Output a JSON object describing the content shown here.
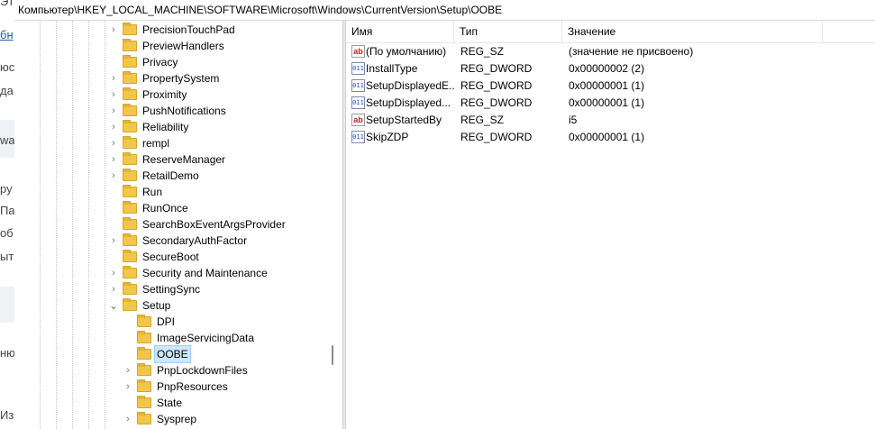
{
  "address_bar": {
    "path": "Компьютер\\HKEY_LOCAL_MACHINE\\SOFTWARE\\Microsoft\\Windows\\CurrentVersion\\Setup\\OOBE"
  },
  "background_page": {
    "fragments": [
      "Эт",
      "бн",
      "юс",
      "да",
      "wa",
      "ру",
      "Па",
      "об",
      "ыт",
      "ню",
      "Из"
    ]
  },
  "tree": {
    "nodes": [
      {
        "label": "PrecisionTouchPad",
        "expander": "collapsed",
        "level": 0
      },
      {
        "label": "PreviewHandlers",
        "expander": "none",
        "level": 0
      },
      {
        "label": "Privacy",
        "expander": "none",
        "level": 0
      },
      {
        "label": "PropertySystem",
        "expander": "collapsed",
        "level": 0
      },
      {
        "label": "Proximity",
        "expander": "collapsed",
        "level": 0
      },
      {
        "label": "PushNotifications",
        "expander": "collapsed",
        "level": 0
      },
      {
        "label": "Reliability",
        "expander": "collapsed",
        "level": 0
      },
      {
        "label": "rempl",
        "expander": "collapsed",
        "level": 0
      },
      {
        "label": "ReserveManager",
        "expander": "collapsed",
        "level": 0
      },
      {
        "label": "RetailDemo",
        "expander": "collapsed",
        "level": 0
      },
      {
        "label": "Run",
        "expander": "none",
        "level": 0
      },
      {
        "label": "RunOnce",
        "expander": "none",
        "level": 0
      },
      {
        "label": "SearchBoxEventArgsProvider",
        "expander": "none",
        "level": 0
      },
      {
        "label": "SecondaryAuthFactor",
        "expander": "collapsed",
        "level": 0
      },
      {
        "label": "SecureBoot",
        "expander": "none",
        "level": 0
      },
      {
        "label": "Security and Maintenance",
        "expander": "collapsed",
        "level": 0
      },
      {
        "label": "SettingSync",
        "expander": "collapsed",
        "level": 0
      },
      {
        "label": "Setup",
        "expander": "expanded",
        "level": 0
      },
      {
        "label": "DPI",
        "expander": "none",
        "level": 1
      },
      {
        "label": "ImageServicingData",
        "expander": "none",
        "level": 1
      },
      {
        "label": "OOBE",
        "expander": "none",
        "level": 1,
        "selected": true
      },
      {
        "label": "PnpLockdownFiles",
        "expander": "collapsed",
        "level": 1
      },
      {
        "label": "PnpResources",
        "expander": "collapsed",
        "level": 1
      },
      {
        "label": "State",
        "expander": "none",
        "level": 1
      },
      {
        "label": "Sysprep",
        "expander": "collapsed",
        "level": 1
      }
    ]
  },
  "values": {
    "columns": [
      "Имя",
      "Тип",
      "Значение"
    ],
    "rows": [
      {
        "icon": "reg-sz-icon",
        "name": "(По умолчанию)",
        "type": "REG_SZ",
        "data": "(значение не присвоено)"
      },
      {
        "icon": "reg-dword-icon",
        "name": "InstallType",
        "type": "REG_DWORD",
        "data": "0x00000002 (2)"
      },
      {
        "icon": "reg-dword-icon",
        "name": "SetupDisplayedE...",
        "type": "REG_DWORD",
        "data": "0x00000001 (1)"
      },
      {
        "icon": "reg-dword-icon",
        "name": "SetupDisplayed...",
        "type": "REG_DWORD",
        "data": "0x00000001 (1)"
      },
      {
        "icon": "reg-sz-icon",
        "name": "SetupStartedBy",
        "type": "REG_SZ",
        "data": "i5"
      },
      {
        "icon": "reg-dword-icon",
        "name": "SkipZDP",
        "type": "REG_DWORD",
        "data": "0x00000001 (1)"
      }
    ]
  },
  "icon_glyphs": {
    "reg-sz-icon": "ab",
    "reg-dword-icon": "011"
  },
  "colors": {
    "selection": "#cce8ff",
    "folder": "#f2c64a"
  }
}
